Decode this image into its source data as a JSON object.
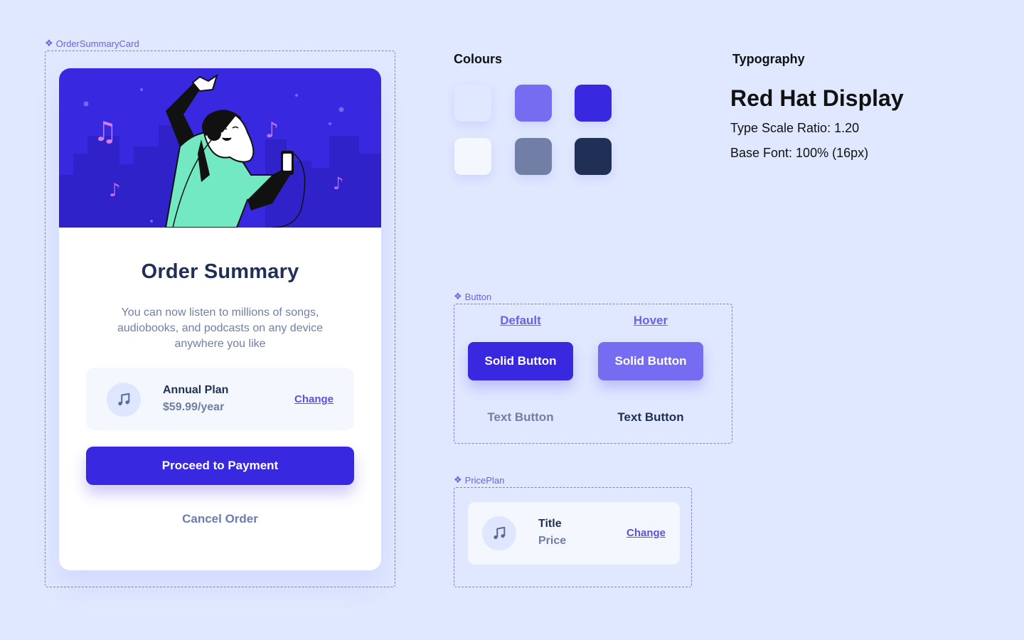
{
  "frames": {
    "order_summary_card": "OrderSummaryCard",
    "button": "Button",
    "price_plan": "PricePlan"
  },
  "card": {
    "title": "Order Summary",
    "description": "You can now listen to millions of songs, audiobooks, and podcasts on any device anywhere you like",
    "plan_name": "Annual Plan",
    "plan_price": "$59.99/year",
    "change_label": "Change",
    "proceed_label": "Proceed to Payment",
    "cancel_label": "Cancel Order"
  },
  "colours": {
    "title": "Colours",
    "swatches": [
      "#e0e8ff",
      "#766cf1",
      "#3829e0",
      "#f5f7ff",
      "#717fa6",
      "#1f2f56"
    ]
  },
  "typography": {
    "title": "Typography",
    "font_name": "Red Hat Display",
    "scale_ratio": "Type Scale Ratio: 1.20",
    "base_font": "Base Font: 100% (16px)"
  },
  "button_component": {
    "default_label": "Default",
    "hover_label": "Hover",
    "solid_default": "Solid Button",
    "solid_hover": "Solid Button",
    "text_default": "Text Button",
    "text_hover": "Text Button"
  },
  "price_plan_component": {
    "title": "Title",
    "price": "Price",
    "change_label": "Change"
  },
  "icons": {
    "component": "component-diamond-icon",
    "music": "music-note-icon"
  },
  "accent_colors": {
    "primary": "#3829e0",
    "primary_hover": "#766cf1",
    "dark": "#1f2f56",
    "desaturated": "#717fa6",
    "background": "#e0e8ff"
  }
}
